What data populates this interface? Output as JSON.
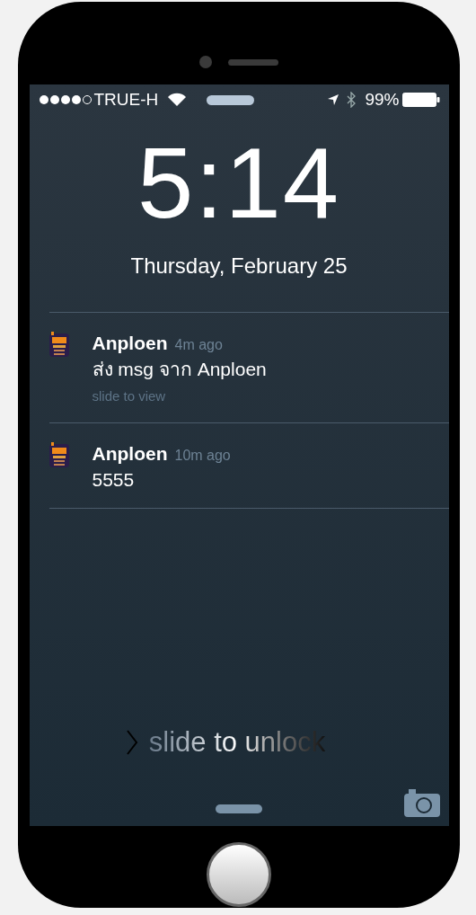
{
  "status_bar": {
    "carrier": "TRUE-H",
    "battery": "99%"
  },
  "lock_screen": {
    "time": "5:14",
    "date": "Thursday, February 25"
  },
  "notifications": [
    {
      "app": "Anploen",
      "time": "4m ago",
      "message": "ส่ง msg จาก Anploen",
      "action": "slide to view"
    },
    {
      "app": "Anploen",
      "time": "10m ago",
      "message": "5555"
    }
  ],
  "unlock": {
    "label": "slide to unlock"
  }
}
